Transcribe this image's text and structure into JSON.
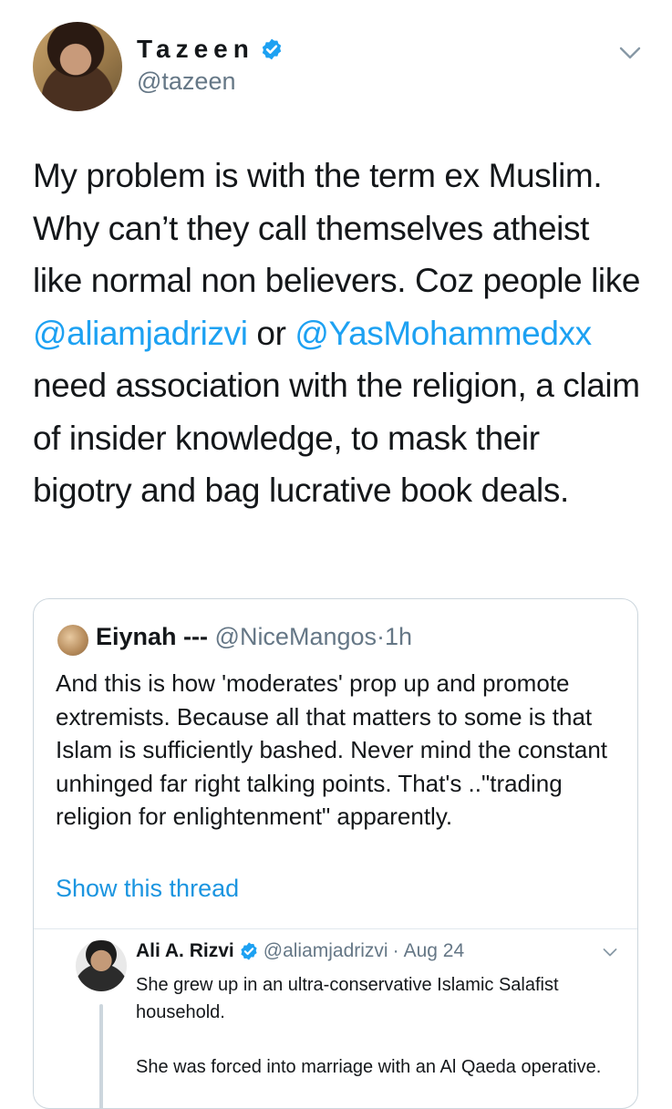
{
  "author": {
    "name": "Tazeen",
    "handle": "@tazeen"
  },
  "tweet": {
    "part1": "My problem is with the term ex Muslim. Why can’t they call themselves atheist like normal non believers. Coz people like  ",
    "mention1": "@aliamjadrizvi",
    "part2": " or ",
    "mention2": "@YasMohammedxx",
    "part3": " need association with the religion, a claim of insider knowledge, to mask their bigotry and bag lucrative book deals."
  },
  "quote": {
    "name": "Eiynah ---",
    "handle": "@NiceMangos",
    "separator": "·",
    "time": "1h",
    "text": "And this is how 'moderates' prop up and promote extremists. Because all that matters to some is that Islam is sufficiently bashed. Never mind the constant unhinged far right talking points. That's ..\"trading religion for enlightenment\" apparently.",
    "show_thread": "Show this thread"
  },
  "reply": {
    "name": "Ali A. Rizvi",
    "handle": "@aliamjadrizvi",
    "separator": "·",
    "date": "Aug 24",
    "text": "She grew up in an ultra-conservative Islamic Salafist household.\n\nShe was forced into marriage with an Al Qaeda operative."
  },
  "colors": {
    "link": "#1da1f2",
    "verified": "#1da1f2",
    "secondary_text": "#657786",
    "border": "#ccd6dd"
  },
  "icons": {
    "verified": "verified-badge-icon",
    "menu": "chevron-down-icon"
  }
}
